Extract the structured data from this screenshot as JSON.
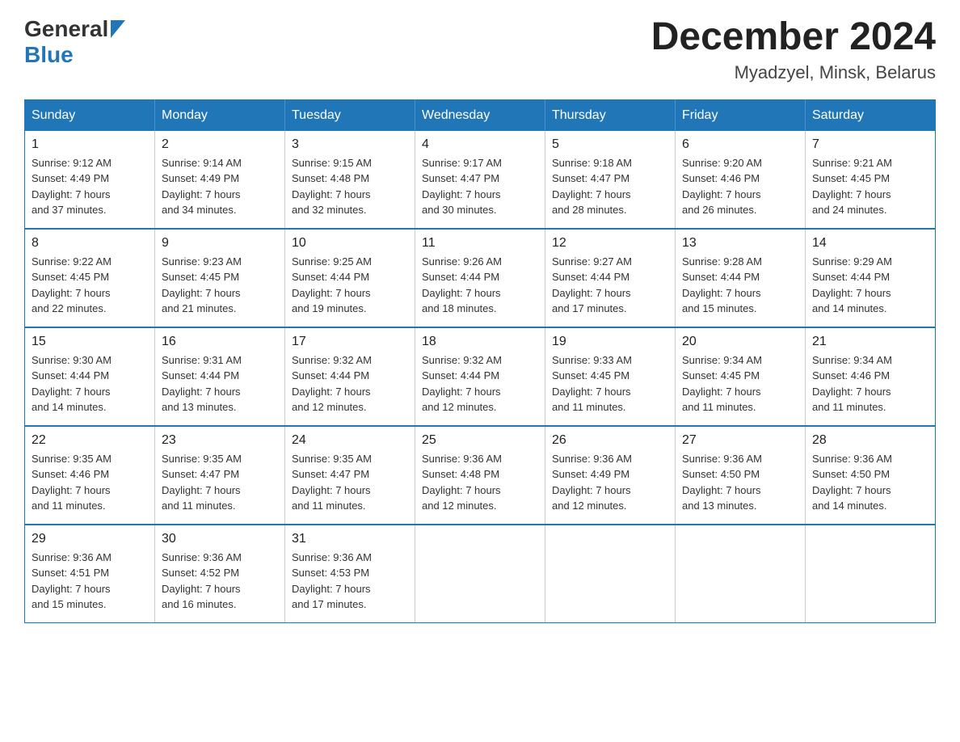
{
  "header": {
    "logo_general": "General",
    "logo_blue": "Blue",
    "month_year": "December 2024",
    "location": "Myadzyel, Minsk, Belarus"
  },
  "days_of_week": [
    "Sunday",
    "Monday",
    "Tuesday",
    "Wednesday",
    "Thursday",
    "Friday",
    "Saturday"
  ],
  "weeks": [
    [
      {
        "day": "1",
        "sunrise": "9:12 AM",
        "sunset": "4:49 PM",
        "daylight": "7 hours and 37 minutes."
      },
      {
        "day": "2",
        "sunrise": "9:14 AM",
        "sunset": "4:49 PM",
        "daylight": "7 hours and 34 minutes."
      },
      {
        "day": "3",
        "sunrise": "9:15 AM",
        "sunset": "4:48 PM",
        "daylight": "7 hours and 32 minutes."
      },
      {
        "day": "4",
        "sunrise": "9:17 AM",
        "sunset": "4:47 PM",
        "daylight": "7 hours and 30 minutes."
      },
      {
        "day": "5",
        "sunrise": "9:18 AM",
        "sunset": "4:47 PM",
        "daylight": "7 hours and 28 minutes."
      },
      {
        "day": "6",
        "sunrise": "9:20 AM",
        "sunset": "4:46 PM",
        "daylight": "7 hours and 26 minutes."
      },
      {
        "day": "7",
        "sunrise": "9:21 AM",
        "sunset": "4:45 PM",
        "daylight": "7 hours and 24 minutes."
      }
    ],
    [
      {
        "day": "8",
        "sunrise": "9:22 AM",
        "sunset": "4:45 PM",
        "daylight": "7 hours and 22 minutes."
      },
      {
        "day": "9",
        "sunrise": "9:23 AM",
        "sunset": "4:45 PM",
        "daylight": "7 hours and 21 minutes."
      },
      {
        "day": "10",
        "sunrise": "9:25 AM",
        "sunset": "4:44 PM",
        "daylight": "7 hours and 19 minutes."
      },
      {
        "day": "11",
        "sunrise": "9:26 AM",
        "sunset": "4:44 PM",
        "daylight": "7 hours and 18 minutes."
      },
      {
        "day": "12",
        "sunrise": "9:27 AM",
        "sunset": "4:44 PM",
        "daylight": "7 hours and 17 minutes."
      },
      {
        "day": "13",
        "sunrise": "9:28 AM",
        "sunset": "4:44 PM",
        "daylight": "7 hours and 15 minutes."
      },
      {
        "day": "14",
        "sunrise": "9:29 AM",
        "sunset": "4:44 PM",
        "daylight": "7 hours and 14 minutes."
      }
    ],
    [
      {
        "day": "15",
        "sunrise": "9:30 AM",
        "sunset": "4:44 PM",
        "daylight": "7 hours and 14 minutes."
      },
      {
        "day": "16",
        "sunrise": "9:31 AM",
        "sunset": "4:44 PM",
        "daylight": "7 hours and 13 minutes."
      },
      {
        "day": "17",
        "sunrise": "9:32 AM",
        "sunset": "4:44 PM",
        "daylight": "7 hours and 12 minutes."
      },
      {
        "day": "18",
        "sunrise": "9:32 AM",
        "sunset": "4:44 PM",
        "daylight": "7 hours and 12 minutes."
      },
      {
        "day": "19",
        "sunrise": "9:33 AM",
        "sunset": "4:45 PM",
        "daylight": "7 hours and 11 minutes."
      },
      {
        "day": "20",
        "sunrise": "9:34 AM",
        "sunset": "4:45 PM",
        "daylight": "7 hours and 11 minutes."
      },
      {
        "day": "21",
        "sunrise": "9:34 AM",
        "sunset": "4:46 PM",
        "daylight": "7 hours and 11 minutes."
      }
    ],
    [
      {
        "day": "22",
        "sunrise": "9:35 AM",
        "sunset": "4:46 PM",
        "daylight": "7 hours and 11 minutes."
      },
      {
        "day": "23",
        "sunrise": "9:35 AM",
        "sunset": "4:47 PM",
        "daylight": "7 hours and 11 minutes."
      },
      {
        "day": "24",
        "sunrise": "9:35 AM",
        "sunset": "4:47 PM",
        "daylight": "7 hours and 11 minutes."
      },
      {
        "day": "25",
        "sunrise": "9:36 AM",
        "sunset": "4:48 PM",
        "daylight": "7 hours and 12 minutes."
      },
      {
        "day": "26",
        "sunrise": "9:36 AM",
        "sunset": "4:49 PM",
        "daylight": "7 hours and 12 minutes."
      },
      {
        "day": "27",
        "sunrise": "9:36 AM",
        "sunset": "4:50 PM",
        "daylight": "7 hours and 13 minutes."
      },
      {
        "day": "28",
        "sunrise": "9:36 AM",
        "sunset": "4:50 PM",
        "daylight": "7 hours and 14 minutes."
      }
    ],
    [
      {
        "day": "29",
        "sunrise": "9:36 AM",
        "sunset": "4:51 PM",
        "daylight": "7 hours and 15 minutes."
      },
      {
        "day": "30",
        "sunrise": "9:36 AM",
        "sunset": "4:52 PM",
        "daylight": "7 hours and 16 minutes."
      },
      {
        "day": "31",
        "sunrise": "9:36 AM",
        "sunset": "4:53 PM",
        "daylight": "7 hours and 17 minutes."
      },
      null,
      null,
      null,
      null
    ]
  ],
  "labels": {
    "sunrise": "Sunrise: ",
    "sunset": "Sunset: ",
    "daylight": "Daylight: "
  }
}
